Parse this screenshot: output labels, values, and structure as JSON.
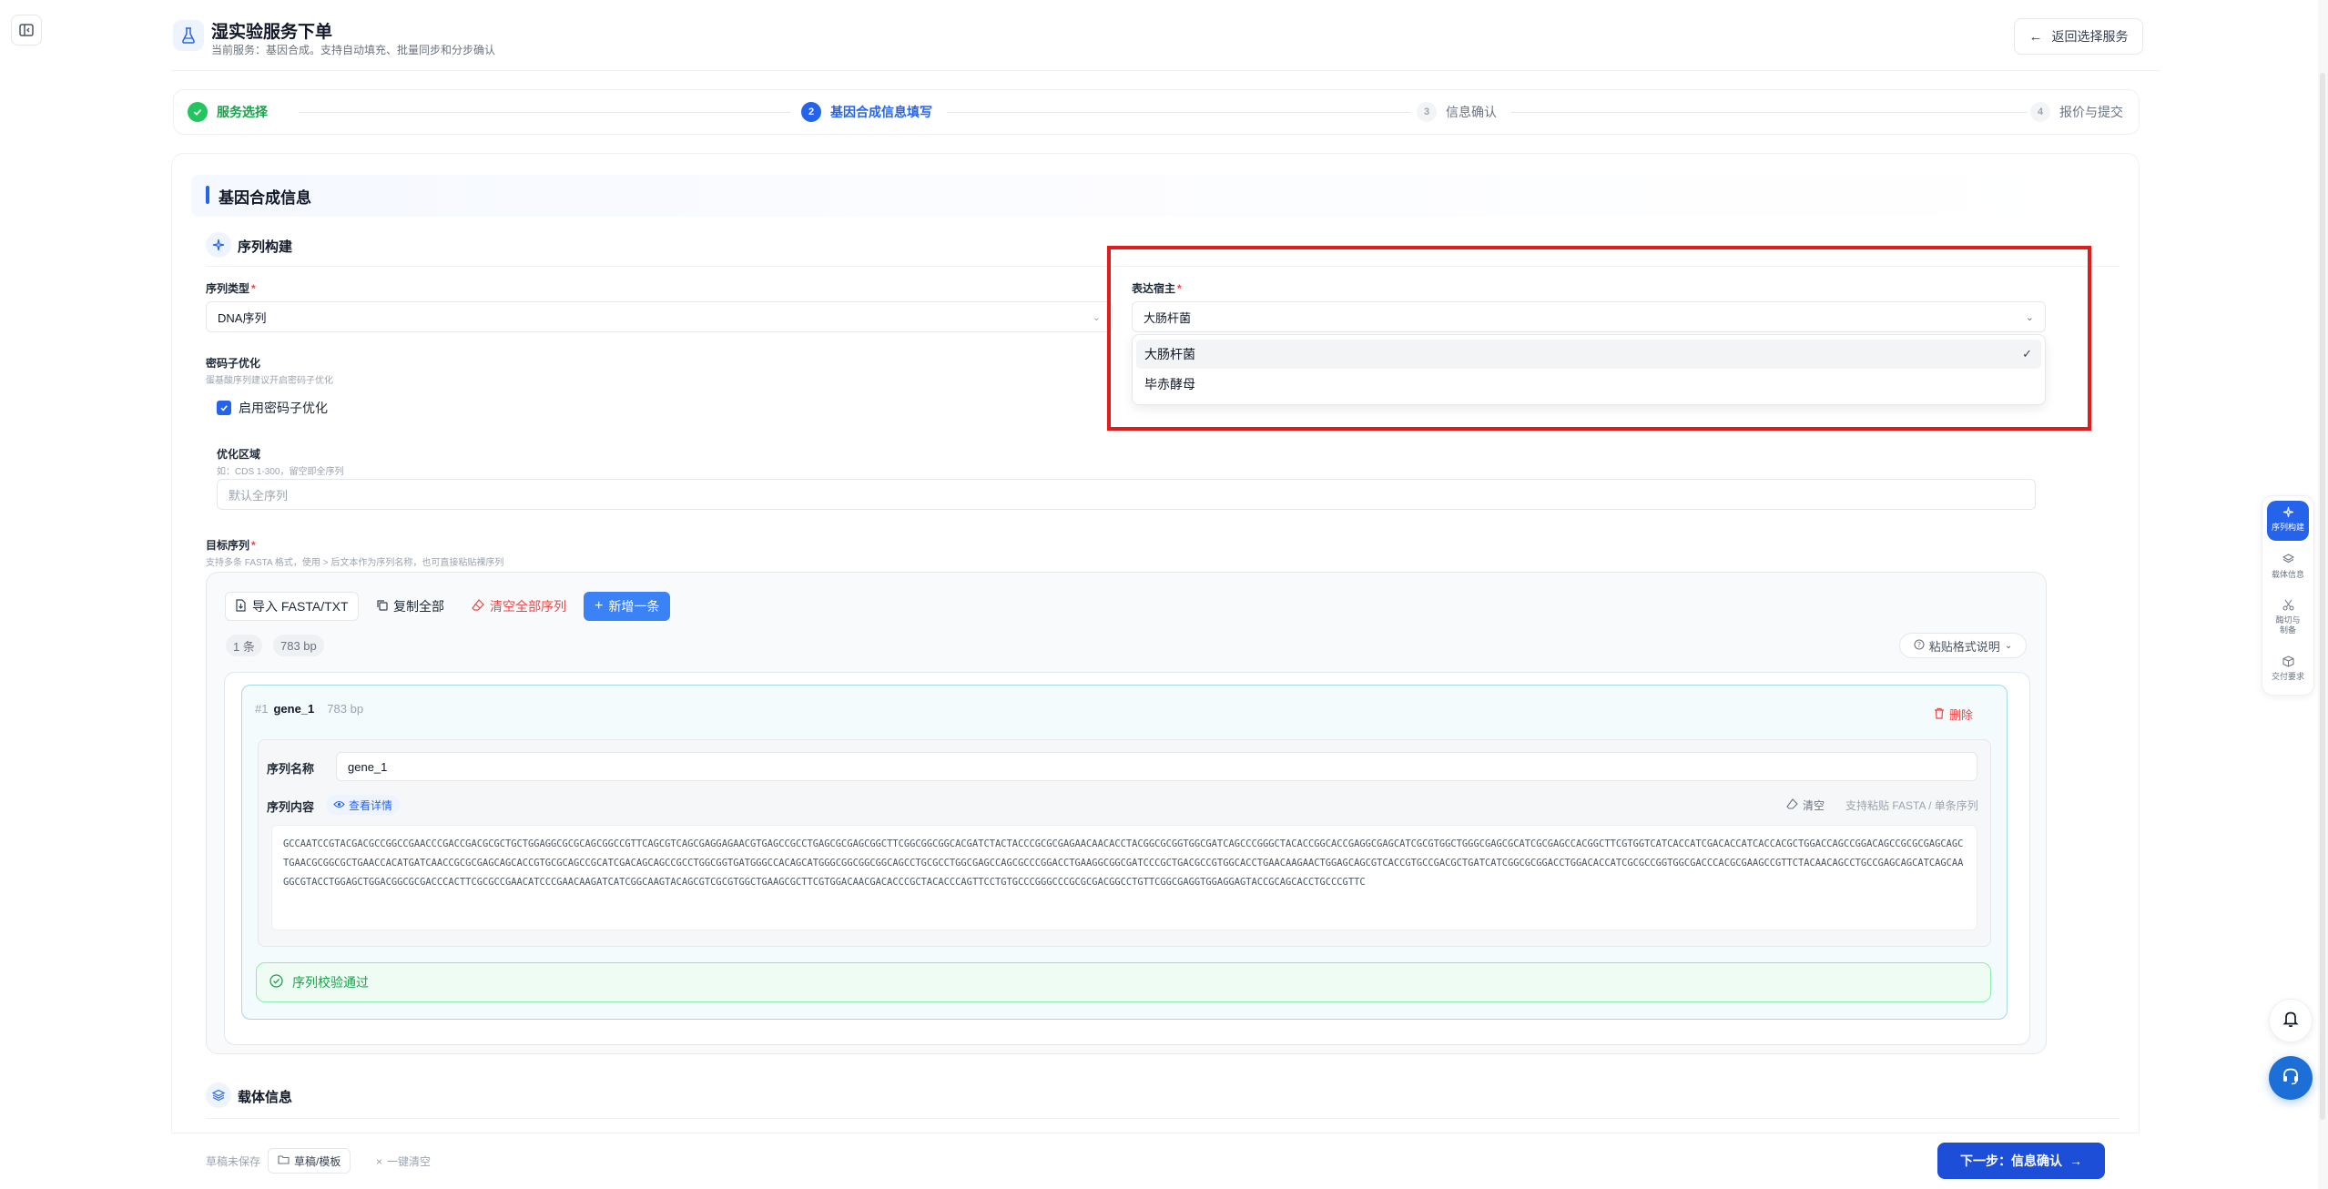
{
  "header": {
    "title": "湿实验服务下单",
    "subtitle": "当前服务：基因合成。支持自动填充、批量同步和分步确认",
    "back_label": "返回选择服务"
  },
  "steps": [
    {
      "num": "",
      "label": "服务选择",
      "state": "done"
    },
    {
      "num": "2",
      "label": "基因合成信息填写",
      "state": "active"
    },
    {
      "num": "3",
      "label": "信息确认",
      "state": "pending"
    },
    {
      "num": "4",
      "label": "报价与提交",
      "state": "pending"
    }
  ],
  "section": {
    "title": "基因合成信息"
  },
  "sequence_build": {
    "title": "序列构建",
    "seq_type_label": "序列类型",
    "seq_type_value": "DNA序列",
    "host_label": "表达宿主",
    "host_value": "大肠杆菌",
    "host_options": [
      "大肠杆菌",
      "毕赤酵母"
    ],
    "codon_label": "密码子优化",
    "codon_hint": "蛋基酸序列建议开启密码子优化",
    "codon_checkbox": "启用密码子优化",
    "region_label": "优化区域",
    "region_hint": "如：CDS 1-300，留空即全序列",
    "region_placeholder": "默认全序列"
  },
  "target": {
    "label": "目标序列",
    "hint": "支持多条 FASTA 格式，使用 > 后文本作为序列名称，也可直接粘贴裸序列",
    "import_label": "导入 FASTA/TXT",
    "copy_label": "复制全部",
    "clear_all_label": "清空全部序列",
    "add_label": "新增一条",
    "count_tag": "1 条",
    "bp_tag": "783 bp",
    "paste_help": "粘贴格式说明"
  },
  "seq_card": {
    "index": "#1",
    "name": "gene_1",
    "bp": "783 bp",
    "delete_label": "删除",
    "name_label": "序列名称",
    "name_value": "gene_1",
    "content_label": "序列内容",
    "view_detail": "查看详情",
    "clear_label": "清空",
    "support_label": "支持粘贴 FASTA / 单条序列",
    "sequence": "GCCAATCCGTACGACGCCGGCCGAACCCGACCGACGCGCTGCTGGAGGCGCGCAGCGGCCGTTCAGCGTCAGCGAGGAGAACGTGAGCCGCCTGAGCGCGAGCGGCTTCGGCGGCGGCACGATCTACTACCCGCGCGAGAACAACACCTACGGCGCGGTGGCGATCAGCCCGGGCTACACCGGCACCGAGGCGAGCATCGCGTGGCTGGGCGAGCGCATCGCGAGCCACGGCTTCGTGGTCATCACCATCGACACCATCACCACGCTGGACCAGCCGGACAGCCGCGCGAGCAGCTGAACGCGGCGCTGAACCACATGATCAACCGCGCGAGCAGCACCGTGCGCAGCCGCATCGACAGCAGCCGCCTGGCGGTGATGGGCCACAGCATGGGCGGCGGCGGCAGCCTGCGCCTGGCGAGCCAGCGCCCGGACCTGAAGGCGGCGATCCCGCTGACGCCGTGGCACCTGAACAAGAACTGGAGCAGCGTCACCGTGCCGACGCTGATCATCGGCGCGGACCTGGACACCATCGCGCCGGTGGCGACCCACGCGAAGCCGTTCTACAACAGCCTGCCGAGCAGCATCAGCAAGGCGTACCTGGAGCTGGACGGCGCGACCCACTTCGCGCCGAACATCCCGAACAAGATCATCGGCAAGTACAGCGTCGCGTGGCTGAAGCGCTTCGTGGACAACGACACCCGCTACACCCAGTTCCTGTGCCCGGGCCCGCGCGACGGCCTGTTCGGCGAGGTGGAGGAGTACCGCAGCACCTGCCCGTTC",
    "valid_label": "序列校验通过"
  },
  "vector": {
    "title": "载体信息"
  },
  "footer": {
    "draft_status": "草稿未保存",
    "draft_template": "草稿/模板",
    "clear_all": "一键清空",
    "next_label": "下一步：信息确认"
  },
  "rail": [
    {
      "label": "序列构建",
      "icon": "sparkle-icon",
      "active": true
    },
    {
      "label": "载体信息",
      "icon": "layers-icon",
      "active": false
    },
    {
      "label": "酶切与制备",
      "icon": "scissors-icon",
      "active": false
    },
    {
      "label": "交付要求",
      "icon": "box-icon",
      "active": false
    }
  ],
  "colors": {
    "primary": "#2563eb",
    "success": "#16a34a",
    "danger": "#ef4444",
    "highlight": "#e31b1b"
  }
}
